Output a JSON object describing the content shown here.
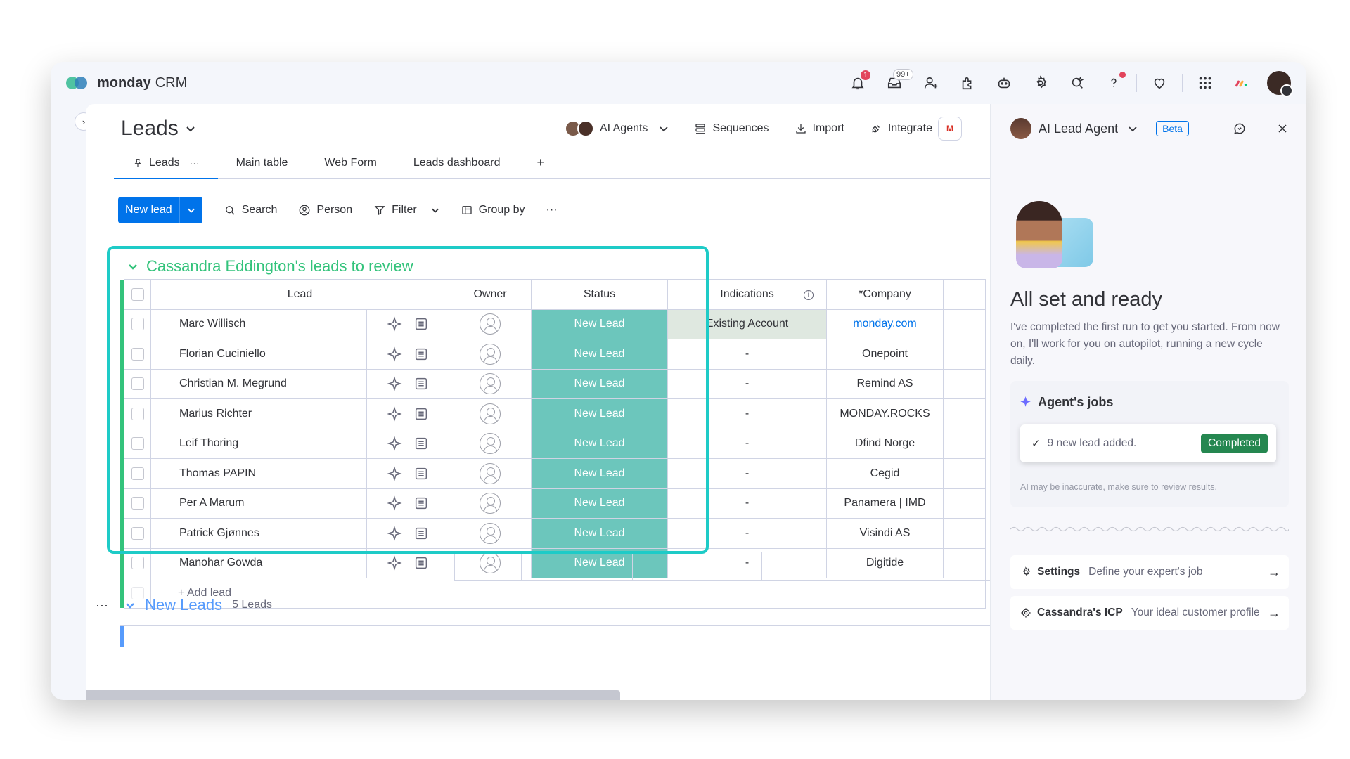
{
  "app": {
    "brand_bold": "monday",
    "brand_light": "CRM"
  },
  "topbar": {
    "notifications_badge": "1",
    "inbox_badge": "99+",
    "icons": [
      "bell-icon",
      "inbox-icon",
      "invite-icon",
      "apps-icon",
      "robot-icon",
      "gear-icon",
      "search-icon",
      "help-icon",
      "heart-icon",
      "grid-icon",
      "monday-apps-icon",
      "avatar"
    ]
  },
  "board": {
    "title": "Leads",
    "actions": {
      "ai_agents": "AI Agents",
      "sequences": "Sequences",
      "import": "Import",
      "integrate": "Integrate",
      "gmail_letter": "M"
    },
    "tabs": [
      {
        "label": "Leads"
      },
      {
        "label": "Main table"
      },
      {
        "label": "Web Form"
      },
      {
        "label": "Leads dashboard"
      }
    ],
    "add_tab": "+",
    "toolbar": {
      "new_lead": "New lead",
      "search": "Search",
      "person": "Person",
      "filter": "Filter",
      "group_by": "Group by",
      "more": "···"
    }
  },
  "group": {
    "title": "Cassandra Eddington's leads to review",
    "columns": {
      "lead": "Lead",
      "owner": "Owner",
      "status": "Status",
      "indications": "Indications",
      "company": "*Company"
    },
    "rows": [
      {
        "lead": "Marc Willisch",
        "status": "New Lead",
        "indication": "Existing Account",
        "company": "monday.com"
      },
      {
        "lead": "Florian Cuciniello",
        "status": "New Lead",
        "indication": "-",
        "company": "Onepoint"
      },
      {
        "lead": "Christian M. Megrund",
        "status": "New Lead",
        "indication": "-",
        "company": "Remind AS"
      },
      {
        "lead": "Marius Richter",
        "status": "New Lead",
        "indication": "-",
        "company": "MONDAY.ROCKS"
      },
      {
        "lead": "Leif Thoring",
        "status": "New Lead",
        "indication": "-",
        "company": "Dfind Norge"
      },
      {
        "lead": "Thomas PAPIN",
        "status": "New Lead",
        "indication": "-",
        "company": "Cegid"
      },
      {
        "lead": "Per A Marum",
        "status": "New Lead",
        "indication": "-",
        "company": "Panamera | IMD"
      },
      {
        "lead": "Patrick Gjønnes",
        "status": "New Lead",
        "indication": "-",
        "company": "Visindi AS"
      },
      {
        "lead": "Manohar Gowda",
        "status": "New Lead",
        "indication": "-",
        "company": "Digitide"
      }
    ],
    "add_lead": "+ Add lead"
  },
  "group2": {
    "title": "New Leads",
    "count": "5 Leads",
    "menu": "···"
  },
  "colors": {
    "accent": "#0073ea",
    "group_green": "#33c37b",
    "status_teal": "#6cc6bc",
    "highlight": "#1ecbc7",
    "completed_green": "#258750",
    "new_leads_blue": "#579bfc"
  },
  "agent": {
    "name": "AI Lead Agent",
    "beta": "Beta",
    "heading": "All set and ready",
    "body": "I've completed the first run to get you started. From now on, I'll work for you on autopilot, running a new cycle daily.",
    "jobs_title": "Agent's jobs",
    "job_text": "9 new lead added.",
    "job_status": "Completed",
    "disclaimer": "AI may be inaccurate, make sure to review results.",
    "settings_label": "Settings",
    "settings_sub": "Define your expert's job",
    "icp_label": "Cassandra's ICP",
    "icp_sub": "Your ideal customer profile"
  }
}
